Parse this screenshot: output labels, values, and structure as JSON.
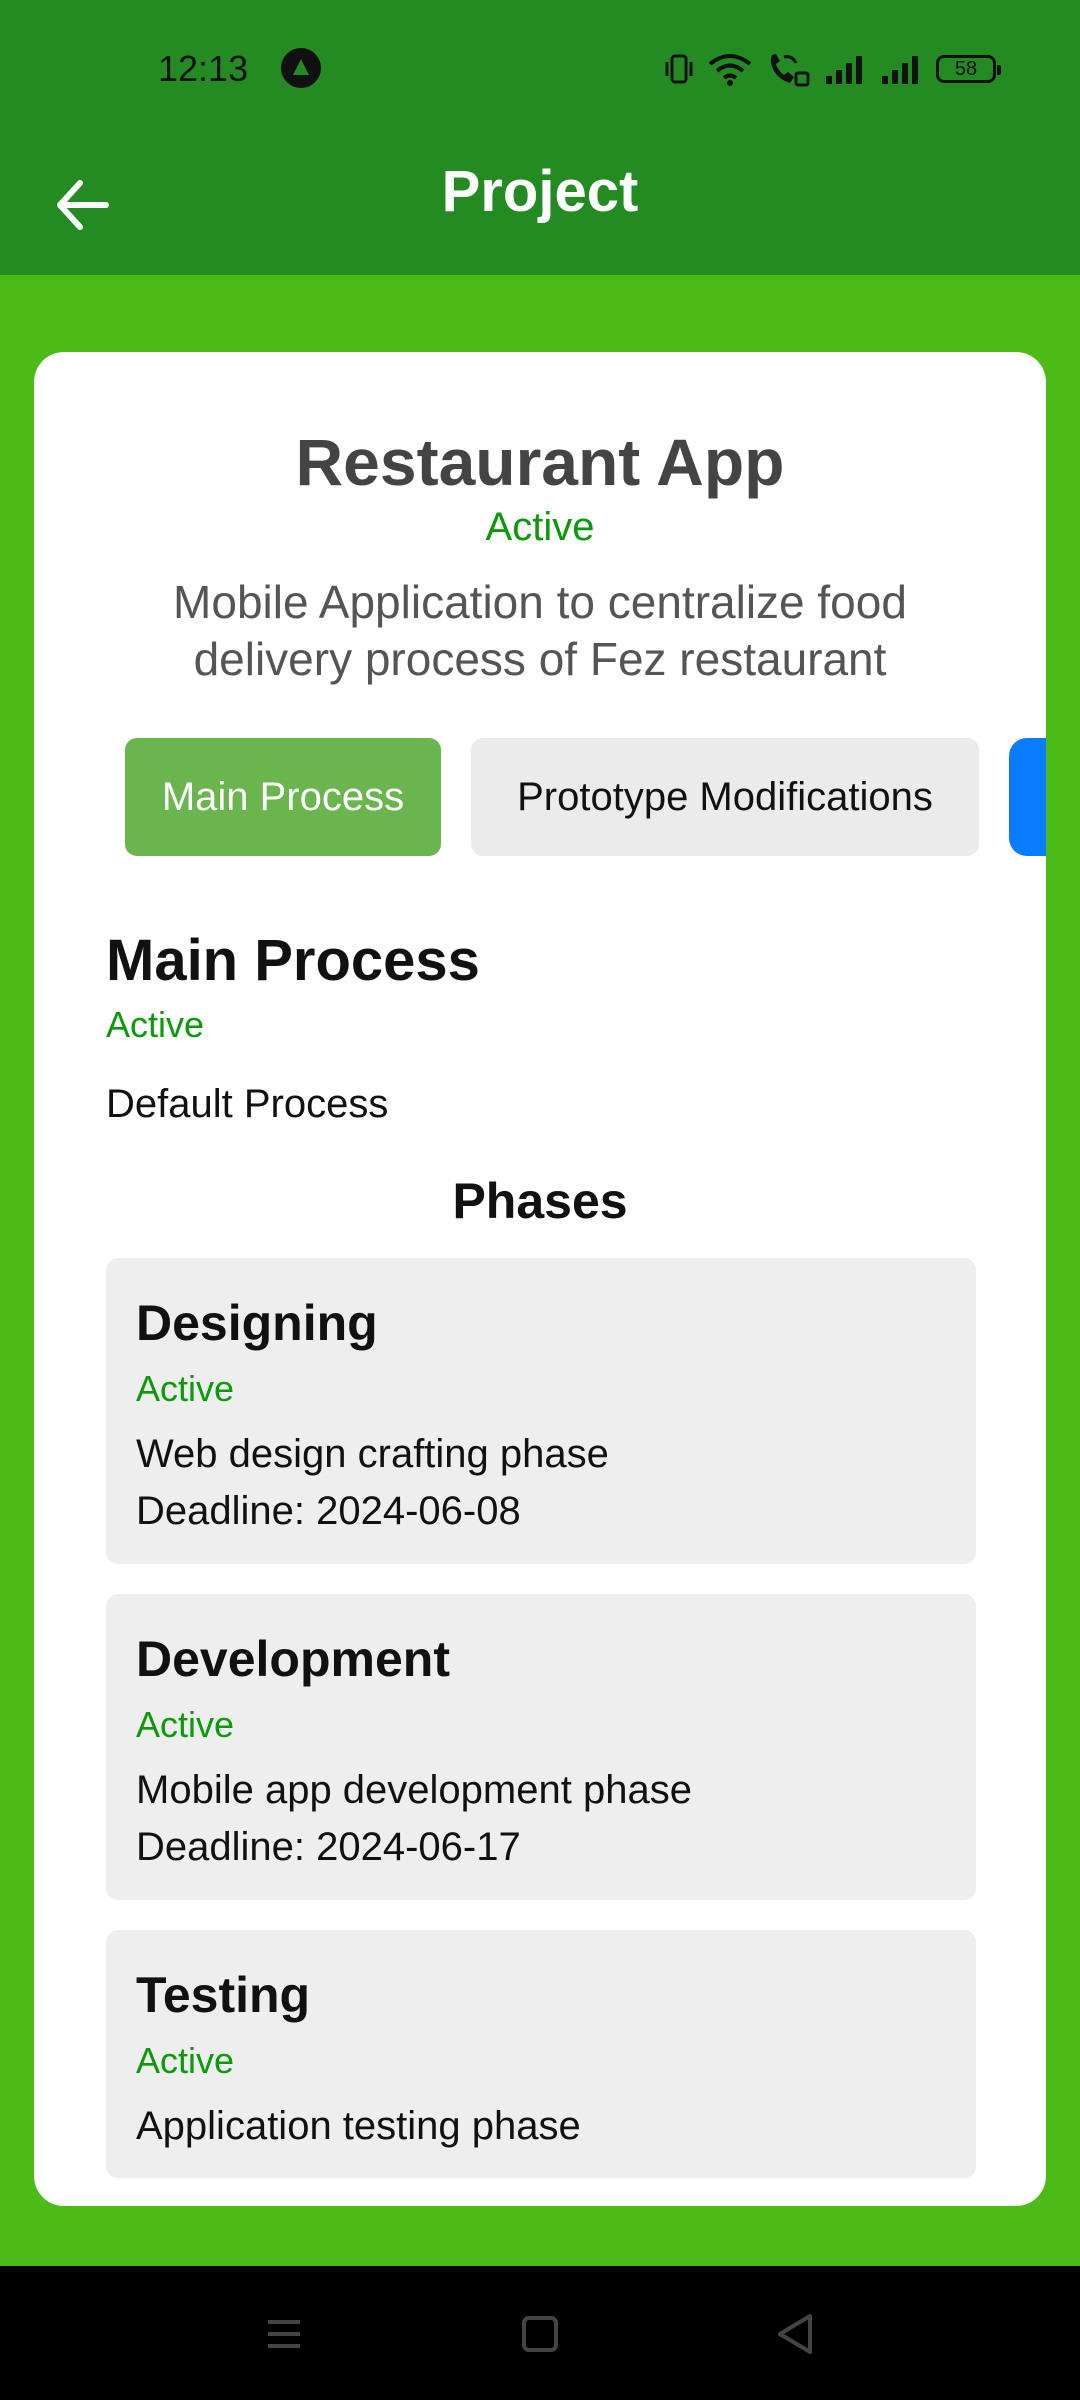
{
  "status_bar": {
    "time": "12:13",
    "battery": "58"
  },
  "app_bar": {
    "title": "Project"
  },
  "project": {
    "title": "Restaurant App",
    "status": "Active",
    "description": "Mobile Application to centralize food delivery process of Fez restaurant"
  },
  "tabs": [
    {
      "label": "Main Process",
      "selected": true
    },
    {
      "label": "Prototype Modifications",
      "selected": false
    }
  ],
  "process": {
    "title": "Main Process",
    "status": "Active",
    "subtitle": "Default Process",
    "phases_heading": "Phases",
    "phases": [
      {
        "name": "Designing",
        "status": "Active",
        "description": "Web design crafting phase",
        "deadline": "Deadline: 2024-06-08"
      },
      {
        "name": "Development",
        "status": "Active",
        "description": "Mobile app development phase",
        "deadline": "Deadline: 2024-06-17"
      },
      {
        "name": "Testing",
        "status": "Active",
        "description": "Application testing phase"
      }
    ]
  },
  "colors": {
    "background_green": "#4cbb17",
    "header_green": "#248b23",
    "active_tab": "#6ab54d",
    "status_green": "#0a9a0a",
    "partial_tab_blue": "#0a7cff"
  },
  "icons": [
    "back-arrow-icon",
    "vibrate-icon",
    "wifi-icon",
    "wifi-call-icon",
    "signal-icon",
    "signal-icon-2",
    "battery-icon",
    "menu-nav-icon",
    "home-nav-icon",
    "back-nav-icon"
  ]
}
